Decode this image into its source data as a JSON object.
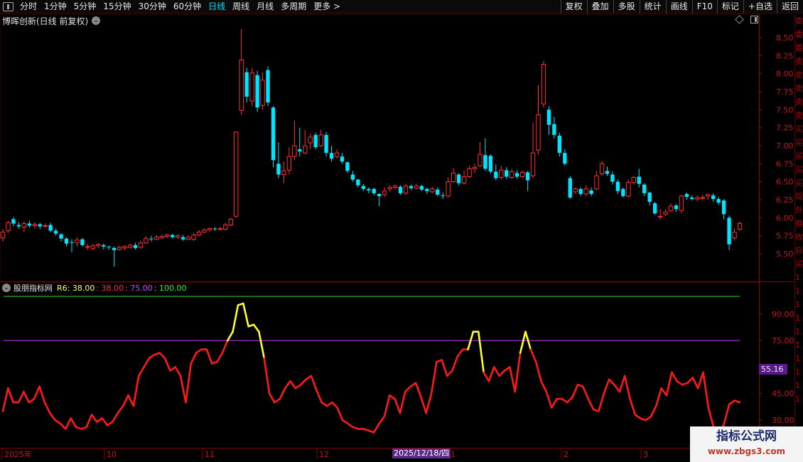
{
  "toolbar": {
    "periods": [
      "分时",
      "1分钟",
      "5分钟",
      "15分钟",
      "30分钟",
      "60分钟",
      "日线",
      "周线",
      "月线",
      "多周期",
      "更多 >"
    ],
    "active_period": "日线",
    "tools": [
      "复权",
      "叠加",
      "多股",
      "统计",
      "画线",
      "F10",
      "标记",
      "+自选",
      "返回"
    ]
  },
  "main_panel": {
    "title": "博晖创新(日线 前复权)",
    "price_ticks": [
      "8.50",
      "8.25",
      "8.00",
      "7.75",
      "7.50",
      "7.25",
      "7.00",
      "6.75",
      "6.50",
      "6.25",
      "6.00",
      "5.75",
      "5.50"
    ]
  },
  "sub_panel": {
    "name": "股朋指标网",
    "params": [
      {
        "text": "R6: 38.00",
        "color": "#ffff66"
      },
      {
        "text": ": 38.00",
        "color": "#ff2a2a"
      },
      {
        "text": ": 75.00",
        "color": "#d040ff"
      },
      {
        "text": ": 100.00",
        "color": "#33ee33"
      }
    ],
    "ticks": [
      "90.00",
      "75.00",
      "45.00",
      "30.00"
    ],
    "current_value": "55.16"
  },
  "date_axis": {
    "labels": [
      "2025年",
      "10",
      "11",
      "12",
      "1",
      "2",
      "3"
    ],
    "cursor_date": "2025/12/18/四"
  },
  "right_column_glyphs": [
    "委",
    "委",
    "委",
    "卖",
    "卖",
    "卖",
    "卖",
    "卖",
    "买",
    "买",
    "买",
    "买",
    "买",
    "现",
    "外",
    "换",
    "收",
    "自",
    "买",
    "1",
    "1",
    "1",
    "1",
    "1",
    "1",
    "1",
    "1",
    "1",
    "1"
  ],
  "watermark": {
    "line1": "指标公式网",
    "line2": "www.zbgs3.com"
  },
  "colors": {
    "up": "#ff3030",
    "down": "#00e5ff",
    "ind_main": "#ff1a1a",
    "ind_hot": "#ffff33",
    "line100": "#33dd33",
    "line75": "#cc33ff",
    "grid": "#3a0000"
  },
  "chart_data": {
    "type": "candlestick",
    "ylim": [
      5.3,
      8.65
    ],
    "indicator_ylim": [
      28,
      100
    ],
    "candles": [
      [
        5.72,
        5.8,
        5.67,
        5.84
      ],
      [
        5.82,
        5.93,
        5.79,
        5.96
      ],
      [
        5.98,
        5.92,
        5.88,
        6.01
      ],
      [
        5.9,
        5.88,
        5.85,
        5.94
      ],
      [
        5.87,
        5.92,
        5.8,
        5.95
      ],
      [
        5.92,
        5.89,
        5.86,
        5.96
      ],
      [
        5.89,
        5.91,
        5.85,
        5.94
      ],
      [
        5.91,
        5.88,
        5.84,
        5.93
      ],
      [
        5.88,
        5.89,
        5.86,
        5.92
      ],
      [
        5.9,
        5.82,
        5.8,
        5.93
      ],
      [
        5.82,
        5.78,
        5.75,
        5.85
      ],
      [
        5.77,
        5.71,
        5.67,
        5.79
      ],
      [
        5.71,
        5.64,
        5.6,
        5.73
      ],
      [
        5.66,
        5.65,
        5.52,
        5.7
      ],
      [
        5.65,
        5.69,
        5.6,
        5.73
      ],
      [
        5.7,
        5.62,
        5.6,
        5.72
      ],
      [
        5.6,
        5.6,
        5.55,
        5.64
      ],
      [
        5.57,
        5.61,
        5.55,
        5.64
      ],
      [
        5.61,
        5.63,
        5.58,
        5.65
      ],
      [
        5.62,
        5.6,
        5.56,
        5.64
      ],
      [
        5.6,
        5.59,
        5.55,
        5.61
      ],
      [
        5.58,
        5.55,
        5.32,
        5.6
      ],
      [
        5.56,
        5.59,
        5.54,
        5.61
      ],
      [
        5.58,
        5.6,
        5.55,
        5.62
      ],
      [
        5.59,
        5.62,
        5.57,
        5.64
      ],
      [
        5.62,
        5.58,
        5.56,
        5.65
      ],
      [
        5.59,
        5.65,
        5.57,
        5.68
      ],
      [
        5.65,
        5.71,
        5.64,
        5.74
      ],
      [
        5.71,
        5.7,
        5.67,
        5.75
      ],
      [
        5.7,
        5.73,
        5.69,
        5.76
      ],
      [
        5.72,
        5.74,
        5.71,
        5.77
      ],
      [
        5.74,
        5.76,
        5.72,
        5.78
      ],
      [
        5.76,
        5.73,
        5.71,
        5.78
      ],
      [
        5.73,
        5.75,
        5.71,
        5.77
      ],
      [
        5.73,
        5.7,
        5.68,
        5.76
      ],
      [
        5.7,
        5.73,
        5.69,
        5.75
      ],
      [
        5.7,
        5.76,
        5.68,
        5.79
      ],
      [
        5.76,
        5.8,
        5.74,
        5.83
      ],
      [
        5.8,
        5.83,
        5.79,
        5.85
      ],
      [
        5.83,
        5.85,
        5.81,
        5.87
      ],
      [
        5.85,
        5.84,
        5.82,
        5.87
      ],
      [
        5.84,
        5.85,
        5.82,
        5.87
      ],
      [
        5.84,
        5.9,
        5.82,
        5.93
      ],
      [
        5.9,
        5.98,
        5.88,
        6.0
      ],
      [
        6.02,
        7.19,
        6.0,
        7.19
      ],
      [
        7.49,
        8.19,
        7.43,
        8.62
      ],
      [
        8.02,
        7.68,
        7.6,
        8.08
      ],
      [
        7.62,
        8.01,
        7.55,
        8.08
      ],
      [
        7.98,
        7.53,
        7.47,
        8.04
      ],
      [
        7.56,
        7.91,
        7.5,
        8.02
      ],
      [
        8.05,
        7.6,
        7.55,
        8.1
      ],
      [
        7.53,
        6.8,
        6.7,
        7.55
      ],
      [
        6.75,
        6.6,
        6.55,
        7.05
      ],
      [
        6.6,
        6.65,
        6.48,
        6.78
      ],
      [
        6.66,
        6.85,
        6.6,
        6.98
      ],
      [
        6.85,
        7.0,
        6.8,
        7.35
      ],
      [
        6.95,
        6.92,
        6.85,
        7.25
      ],
      [
        6.9,
        7.0,
        6.88,
        7.22
      ],
      [
        7.04,
        7.12,
        6.95,
        7.17
      ],
      [
        7.15,
        6.98,
        6.95,
        7.18
      ],
      [
        7.0,
        7.15,
        6.98,
        7.22
      ],
      [
        7.15,
        6.9,
        6.85,
        7.19
      ],
      [
        6.9,
        6.82,
        6.78,
        7.0
      ],
      [
        6.85,
        6.9,
        6.82,
        6.95
      ],
      [
        6.85,
        6.78,
        6.75,
        6.9
      ],
      [
        6.77,
        6.65,
        6.62,
        6.78
      ],
      [
        6.6,
        6.53,
        6.5,
        6.65
      ],
      [
        6.53,
        6.45,
        6.42,
        6.54
      ],
      [
        6.44,
        6.4,
        6.37,
        6.47
      ],
      [
        6.4,
        6.38,
        6.34,
        6.42
      ],
      [
        6.4,
        6.34,
        6.31,
        6.42
      ],
      [
        6.33,
        6.3,
        6.16,
        6.34
      ],
      [
        6.32,
        6.37,
        6.29,
        6.42
      ],
      [
        6.4,
        6.42,
        6.36,
        6.45
      ],
      [
        6.42,
        6.44,
        6.4,
        6.46
      ],
      [
        6.43,
        6.34,
        6.32,
        6.45
      ],
      [
        6.34,
        6.44,
        6.32,
        6.47
      ],
      [
        6.44,
        6.41,
        6.38,
        6.46
      ],
      [
        6.41,
        6.44,
        6.39,
        6.47
      ],
      [
        6.44,
        6.39,
        6.37,
        6.46
      ],
      [
        6.4,
        6.37,
        6.33,
        6.42
      ],
      [
        6.36,
        6.4,
        6.34,
        6.43
      ],
      [
        6.39,
        6.32,
        6.3,
        6.42
      ],
      [
        6.31,
        6.3,
        6.26,
        6.35
      ],
      [
        6.3,
        6.5,
        6.28,
        6.56
      ],
      [
        6.5,
        6.62,
        6.48,
        6.69
      ],
      [
        6.6,
        6.48,
        6.45,
        6.62
      ],
      [
        6.48,
        6.57,
        6.46,
        6.66
      ],
      [
        6.57,
        6.68,
        6.55,
        6.72
      ],
      [
        6.68,
        6.7,
        6.62,
        6.75
      ],
      [
        6.72,
        6.88,
        6.7,
        7.05
      ],
      [
        6.87,
        6.68,
        6.65,
        7.1
      ],
      [
        6.86,
        6.64,
        6.61,
        6.88
      ],
      [
        6.64,
        6.55,
        6.52,
        6.74
      ],
      [
        6.56,
        6.66,
        6.53,
        6.72
      ],
      [
        6.66,
        6.57,
        6.54,
        6.7
      ],
      [
        6.56,
        6.64,
        6.54,
        6.68
      ],
      [
        6.62,
        6.57,
        6.54,
        6.66
      ],
      [
        6.57,
        6.63,
        6.55,
        6.66
      ],
      [
        6.63,
        6.52,
        6.37,
        6.65
      ],
      [
        6.58,
        6.9,
        6.55,
        7.32
      ],
      [
        6.94,
        7.43,
        6.88,
        7.84
      ],
      [
        7.58,
        8.13,
        7.53,
        8.18
      ],
      [
        7.5,
        7.29,
        7.15,
        7.55
      ],
      [
        7.3,
        7.15,
        7.1,
        7.4
      ],
      [
        7.14,
        6.9,
        6.85,
        7.18
      ],
      [
        6.9,
        6.75,
        6.72,
        6.95
      ],
      [
        6.55,
        6.28,
        6.26,
        6.58
      ],
      [
        6.36,
        6.4,
        6.33,
        6.42
      ],
      [
        6.4,
        6.33,
        6.3,
        6.42
      ],
      [
        6.33,
        6.4,
        6.3,
        6.45
      ],
      [
        6.38,
        6.33,
        6.3,
        6.42
      ],
      [
        6.4,
        6.58,
        6.38,
        6.65
      ],
      [
        6.61,
        6.75,
        6.58,
        6.79
      ],
      [
        6.65,
        6.61,
        6.58,
        6.71
      ],
      [
        6.6,
        6.5,
        6.46,
        6.64
      ],
      [
        6.5,
        6.37,
        6.33,
        6.53
      ],
      [
        6.4,
        6.3,
        6.28,
        6.42
      ],
      [
        6.3,
        6.49,
        6.28,
        6.53
      ],
      [
        6.49,
        6.56,
        6.46,
        6.58
      ],
      [
        6.57,
        6.47,
        6.42,
        6.68
      ],
      [
        6.46,
        6.34,
        6.3,
        6.48
      ],
      [
        6.35,
        6.22,
        6.17,
        6.36
      ],
      [
        6.2,
        6.06,
        6.04,
        6.22
      ],
      [
        6.02,
        6.02,
        5.97,
        6.12
      ],
      [
        6.05,
        6.08,
        6.02,
        6.12
      ],
      [
        6.1,
        6.16,
        6.08,
        6.2
      ],
      [
        6.17,
        6.12,
        6.08,
        6.19
      ],
      [
        6.1,
        6.3,
        6.06,
        6.32
      ],
      [
        6.33,
        6.29,
        6.25,
        6.35
      ],
      [
        6.28,
        6.26,
        6.24,
        6.31
      ],
      [
        6.26,
        6.28,
        6.23,
        6.31
      ],
      [
        6.28,
        6.28,
        6.24,
        6.32
      ],
      [
        6.3,
        6.32,
        6.25,
        6.34
      ],
      [
        6.31,
        6.26,
        6.22,
        6.34
      ],
      [
        6.26,
        6.21,
        6.18,
        6.29
      ],
      [
        6.24,
        6.05,
        5.98,
        6.26
      ],
      [
        6.0,
        5.63,
        5.55,
        6.03
      ],
      [
        5.72,
        5.8,
        5.68,
        5.85
      ],
      [
        5.84,
        5.92,
        5.82,
        5.95
      ]
    ],
    "indicator": [
      35,
      48,
      40,
      40,
      46,
      40,
      42,
      49,
      40,
      34,
      30,
      28,
      25,
      31,
      26,
      25,
      26,
      33,
      29,
      31,
      27,
      29,
      34,
      38,
      44,
      38,
      55,
      60,
      65,
      67,
      68,
      65,
      58,
      60,
      55,
      40,
      62,
      68,
      70,
      70,
      62,
      63,
      68,
      75,
      80,
      95,
      96,
      83,
      84,
      80,
      65,
      45,
      40,
      42,
      48,
      52,
      48,
      50,
      53,
      55,
      47,
      40,
      38,
      40,
      37,
      30,
      28,
      26,
      25,
      25,
      24,
      23,
      28,
      32,
      44,
      42,
      34,
      46,
      49,
      51,
      43,
      34,
      45,
      63,
      64,
      55,
      58,
      66,
      70,
      70,
      80,
      80,
      57,
      52,
      60,
      55,
      58,
      60,
      46,
      68,
      80,
      70,
      63,
      52,
      46,
      37,
      42,
      42,
      40,
      43,
      50,
      49,
      42,
      36,
      35,
      45,
      53,
      50,
      46,
      55,
      42,
      33,
      31,
      30,
      32,
      38,
      48,
      44,
      57,
      52,
      50,
      51,
      54,
      48,
      57,
      37,
      26,
      21,
      28,
      39,
      41,
      40
    ]
  }
}
